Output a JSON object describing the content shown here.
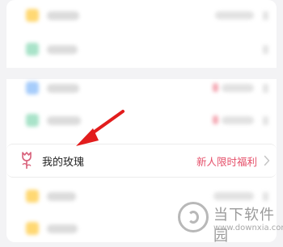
{
  "menu": {
    "highlighted_item": {
      "label": "我的玫瑰",
      "promo": "新人限时福利",
      "icon": "rose-icon"
    }
  },
  "watermark": {
    "brand": "当下软件园",
    "url": "www.downxia.com"
  },
  "colors": {
    "promo": "#e5506a",
    "arrow": "#e21d1d",
    "icon": "#d8607a"
  }
}
